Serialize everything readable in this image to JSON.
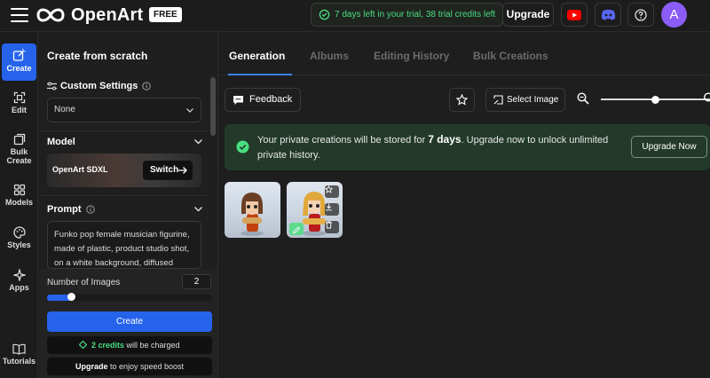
{
  "app": {
    "name": "OpenArt",
    "badge": "FREE"
  },
  "topbar": {
    "trial_text": "7 days left in your trial, 38 trial credits left",
    "upgrade_label": "Upgrade",
    "avatar_initial": "A"
  },
  "rail": {
    "items": [
      {
        "label": "Create",
        "icon": "create-icon"
      },
      {
        "label": "Edit",
        "icon": "edit-icon"
      },
      {
        "label": "Bulk Create",
        "icon": "bulk-create-icon"
      },
      {
        "label": "Models",
        "icon": "models-icon"
      },
      {
        "label": "Styles",
        "icon": "palette-icon"
      },
      {
        "label": "Apps",
        "icon": "apps-icon"
      },
      {
        "label": "Tutorials",
        "icon": "book-icon"
      }
    ]
  },
  "panel": {
    "title": "Create from scratch",
    "custom_settings": {
      "label": "Custom Settings",
      "value": "None"
    },
    "model": {
      "label": "Model",
      "name": "OpenArt SDXL",
      "switch_label": "Switch"
    },
    "prompt": {
      "label": "Prompt",
      "text": "Funko pop female musician figurine, made of plastic, product studio shot, on a white background, diffused"
    },
    "num_images": {
      "label": "Number of Images",
      "value": "2",
      "slider_fraction": 0.15
    },
    "create_label": "Create",
    "credits": {
      "amount": "2 credits",
      "suffix": "will be charged"
    },
    "speed": {
      "link": "Upgrade",
      "suffix": "to enjoy speed boost"
    }
  },
  "main": {
    "tabs": [
      "Generation",
      "Albums",
      "Editing History",
      "Bulk Creations"
    ],
    "active_tab": "Generation",
    "feedback_label": "Feedback",
    "select_image_label": "Select Image",
    "zoom_fraction": 0.5,
    "banner": {
      "text_before": "Your private creations will be stored for",
      "days": "7 days",
      "text_after": ". Upgrade now to unlock unlimited private history.",
      "button": "Upgrade Now"
    }
  },
  "colors": {
    "accent": "#2563eb",
    "success": "#4ade80",
    "banner_bg": "#233a2a",
    "avatar": "#8b5cf6"
  }
}
